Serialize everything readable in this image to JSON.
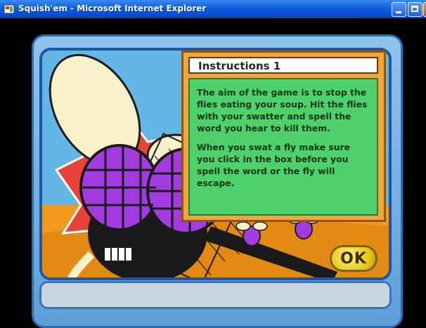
{
  "window": {
    "title": "Squish'em - Microsoft Internet Explorer",
    "icons": [
      "app-icon",
      "minimize-icon",
      "maximize-icon",
      "close-icon"
    ]
  },
  "instructions": {
    "title": "Instructions 1",
    "paragraphs": [
      "The aim of the game is to stop the flies eating your soup. Hit the flies with your swatter and spell the word you hear to kill them.",
      "When you swat a fly make sure you click in the box before you spell the word or the fly will escape."
    ]
  },
  "ok_button": {
    "label": "OK"
  },
  "colors": {
    "titlebar": "#0d5ddc",
    "panel_orange": "#f6a43a",
    "panel_green": "#4ed06a",
    "frame_blue": "#5e9fd8",
    "ok_yellow": "#e3c412"
  }
}
